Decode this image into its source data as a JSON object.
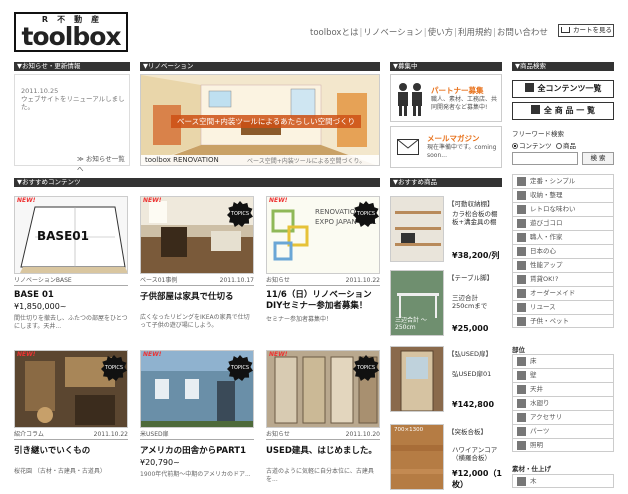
{
  "header": {
    "logo_sub": "R不動産",
    "logo_main": "toolbox",
    "nav": [
      "toolboxとは",
      "リノベーション",
      "使い方",
      "利用規約",
      "お問い合わせ"
    ],
    "cart_label": "カートを見る"
  },
  "news": {
    "header": "▼お知らせ・更新情報",
    "date": "2011.10.25",
    "text": "ウェブサイトをリニューアルしました。",
    "more": "お知らせ一覧へ"
  },
  "renovation": {
    "header": "▼リノベーション",
    "band": "ベース空間+内装ツールによるあたらしい空間づくり",
    "caption_left": "toolbox RENOVATION",
    "caption_right": "ベース空間+内装ツールによる空間づくり。"
  },
  "boshu": {
    "header": "▼募集中",
    "partner_title": "パートナー募集",
    "partner_text": "職人、素材、工務店、共同開発者など募集中!",
    "mail_title": "メールマガジン",
    "mail_text": "現在準備中です。coming soon..."
  },
  "product_search": {
    "header": "▼商品検索",
    "all_contents": "全コンテンツ一覧",
    "all_products": "全 商 品 一 覧",
    "freeword_label": "フリーワード検索",
    "radio_contents": "コンテンツ",
    "radio_products": "商品",
    "search_button": "検 索",
    "categories": [
      "定番・シンプル",
      "収納・整理",
      "レトロな味わい",
      "遊びゴコロ",
      "職人・作家",
      "日本の心",
      "性能アップ",
      "賃貸OK!?",
      "オーダーメイド",
      "リユース",
      "子供・ペット"
    ],
    "bui_label": "部位",
    "bui": [
      "床",
      "壁",
      "天井",
      "水廻り",
      "アクセサリ",
      "パーツ",
      "照明"
    ],
    "material_label": "素材・仕上げ",
    "material_first": "木"
  },
  "recommended": {
    "header": "▼おすすめコンテンツ",
    "new_label": "NEW!",
    "topics_label": "TOPICS",
    "cards": [
      {
        "thumb_text": "BASE01",
        "category": "リノベーションBASE",
        "date": "",
        "title": "BASE 01",
        "price": "¥1,850,000~",
        "desc": "間仕切りを撤去し、ふたつの部屋をひとつにします。天井..."
      },
      {
        "thumb_text": "",
        "category": "ベース01事例",
        "date": "2011.10.17",
        "title": "子供部屋は家具で仕切る",
        "price": "",
        "desc": "広くなったリビングをIKEAの家具で仕切って子供の遊び場にしよう。"
      },
      {
        "thumb_text": "RENOVATION EXPO JAPAN 2011",
        "category": "お知らせ",
        "date": "2011.10.22",
        "title": "11/6（日）リノベーション DIYセミナー参加者募集！",
        "price": "",
        "desc": "セミナー参加者募集中！"
      },
      {
        "thumb_text": "",
        "category": "紹介コラム",
        "date": "2011.10.22",
        "title": "引き継いでいくもの",
        "price": "",
        "desc": "桜花園 （古材・古建具・古道具）"
      },
      {
        "thumb_text": "",
        "category": "米USED扉",
        "date": "",
        "title": "アメリカの田舎からPART1",
        "price": "¥20,790~",
        "desc": "1900年代前期〜中期のアメリカのドア..."
      },
      {
        "thumb_text": "",
        "category": "お知らせ",
        "date": "2011.10.20",
        "title": "USED建具、はじめました。",
        "price": "",
        "desc": "古道のように気軽に自分本位に、古建具を..."
      }
    ]
  },
  "products": {
    "header": "▼おすすめ商品",
    "items": [
      {
        "tag": "【可動収納棚】",
        "name": "カラ松合板の棚板+溝金具の棚",
        "price": "¥38,200/列",
        "img_text": ""
      },
      {
        "tag": "【テーブル脚】",
        "name": "三辺合計250cmまで",
        "price": "¥25,000",
        "img_text": "三辺合計 〜250cm"
      },
      {
        "tag": "【弘USED扉】",
        "name": "弘USED扉01",
        "price": "¥142,800",
        "img_text": ""
      },
      {
        "tag": "【突板合板】",
        "name": "ハワイアンコア（横羅合板）",
        "price": "¥12,000（1枚）",
        "img_text": "700×1300"
      }
    ]
  }
}
